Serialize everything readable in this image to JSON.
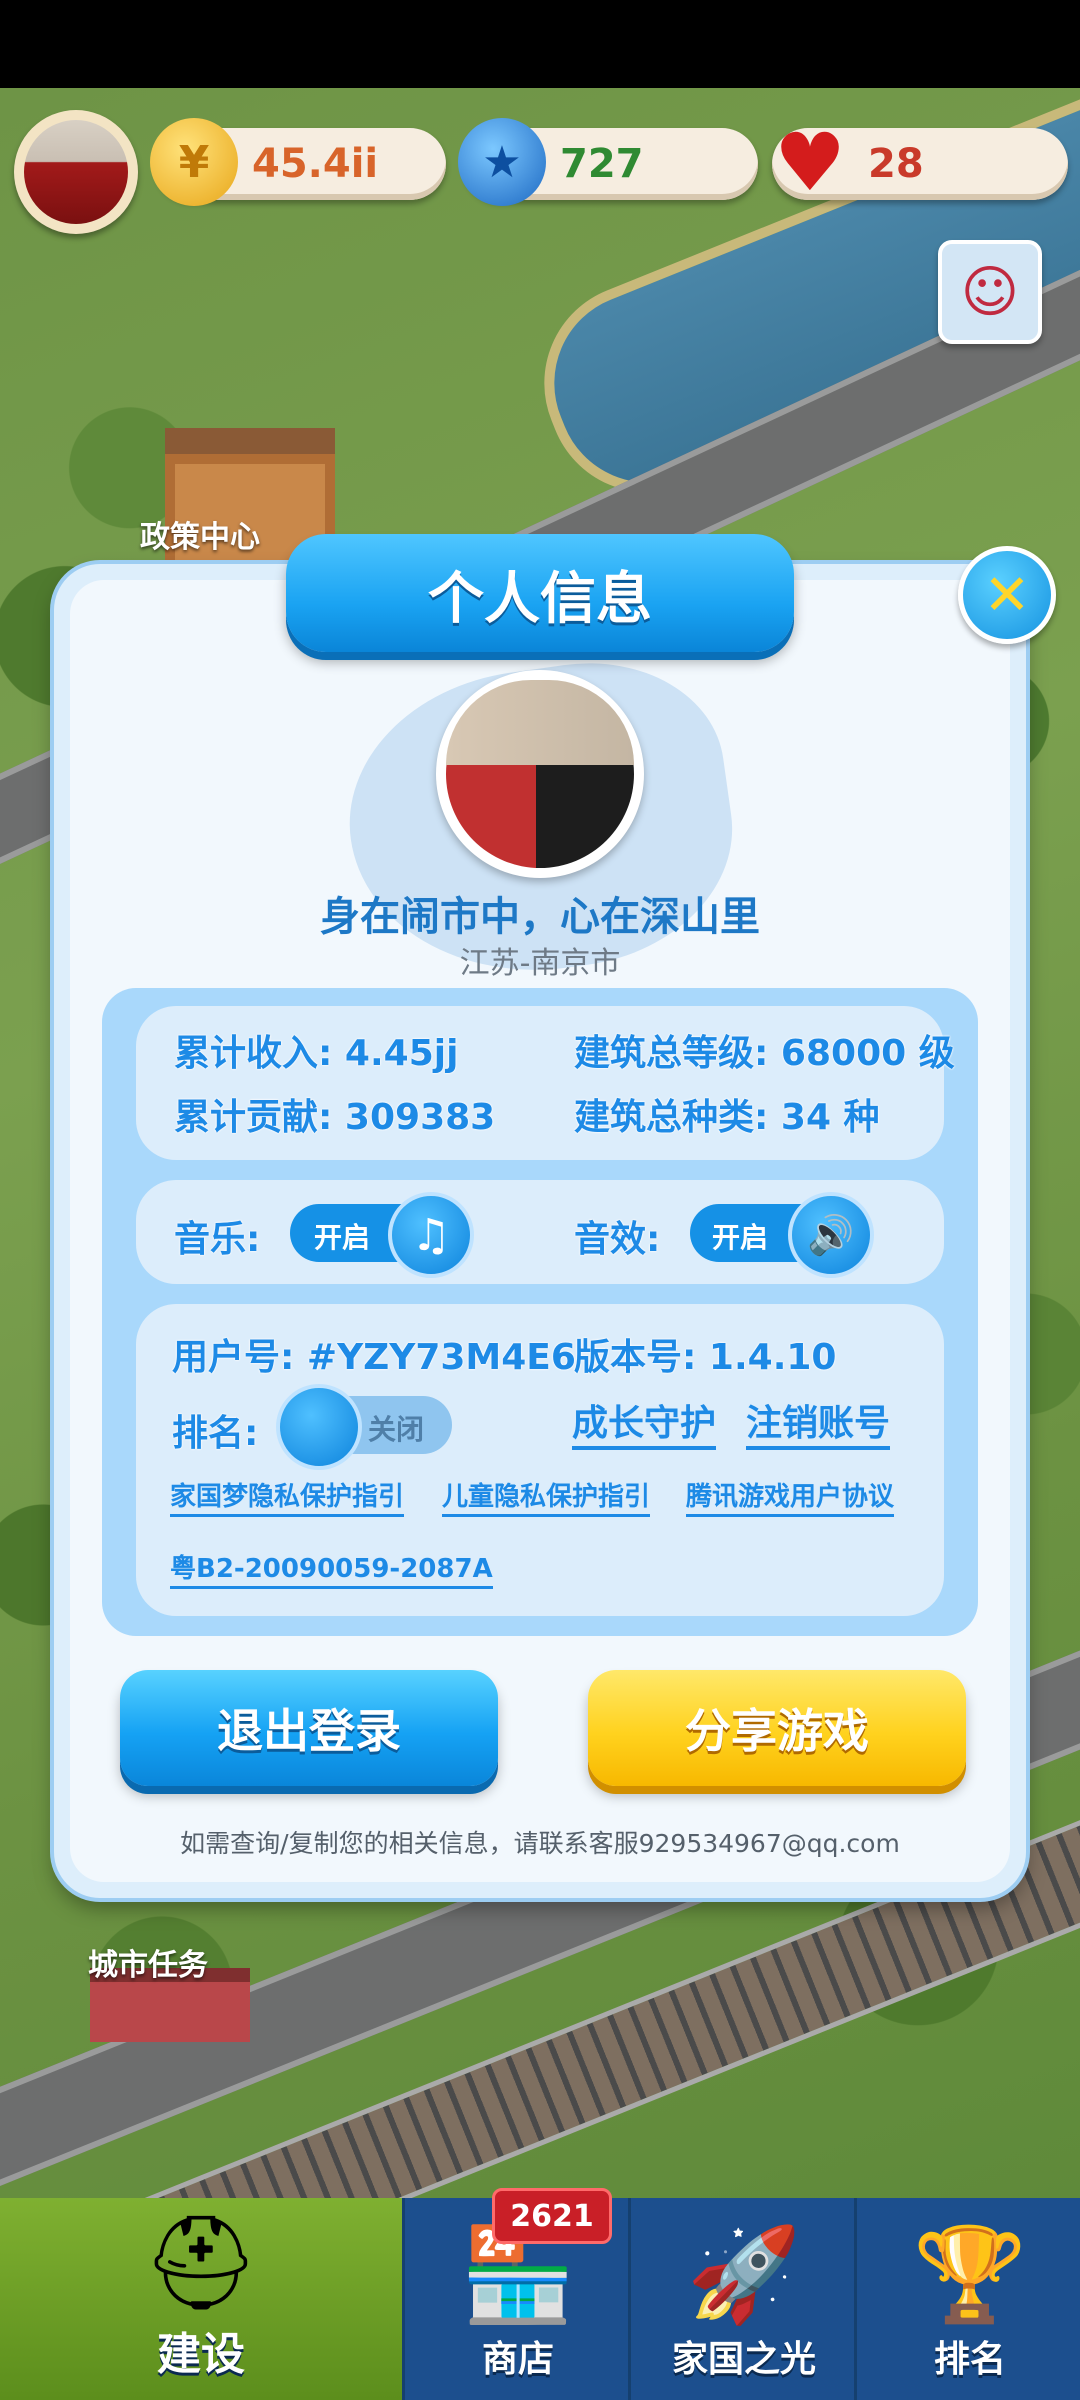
{
  "resources": {
    "coin_value": "45.4ii",
    "star_value": "727",
    "heart_value": "28"
  },
  "map_labels": {
    "policy_center": "政策中心",
    "city_tasks": "城市任务"
  },
  "dialog": {
    "title": "个人信息",
    "motto": "身在闹市中，心在深山里",
    "location": "江苏-南京市",
    "stats": {
      "income": "累计收入: 4.45jj",
      "building_level": "建筑总等级: 68000 级",
      "contribution": "累计贡献: 309383",
      "building_types": "建筑总种类: 34 种"
    },
    "settings": {
      "music_label": "音乐:",
      "music_state": "开启",
      "sound_label": "音效:",
      "sound_state": "开启"
    },
    "account": {
      "user_id": "用户号: #YZY73M4E6",
      "version": "版本号: 1.4.10",
      "ranking_label": "排名:",
      "ranking_state": "关闭",
      "growth_guard": "成长守护",
      "cancel_account": "注销账号",
      "privacy_guide": "家国梦隐私保护指引",
      "child_privacy": "儿童隐私保护指引",
      "user_agreement": "腾讯游戏用户协议",
      "license": "粤B2-20090059-2087A"
    },
    "logout_button": "退出登录",
    "share_button": "分享游戏",
    "footnote": "如需查询/复制您的相关信息，请联系客服929534967@qq.com"
  },
  "bottom_nav": {
    "build": "建设",
    "shop": "商店",
    "shop_badge": "2621",
    "homeland": "家国之光",
    "ranking": "排名"
  },
  "icons": {
    "coin": "coin-icon",
    "star": "star-icon",
    "heart": "heart-icon",
    "close": "close-icon",
    "music": "music-note-icon",
    "sound": "speaker-icon"
  },
  "colors": {
    "primary_blue": "#1d8ae6",
    "title_blue": "#1aa3f2",
    "share_yellow": "#ffd21e",
    "nav_bg": "#1c4f8e"
  }
}
